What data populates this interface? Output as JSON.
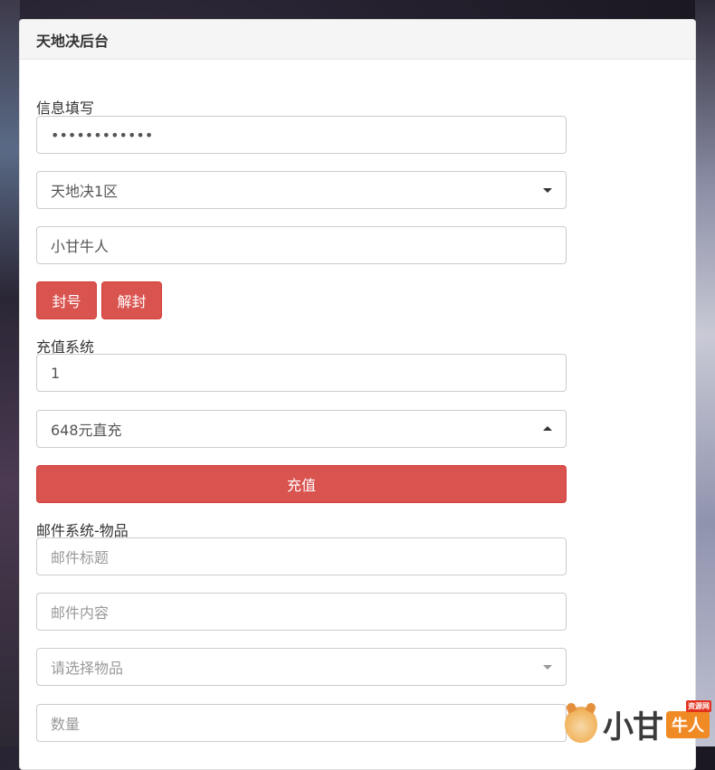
{
  "panel": {
    "title": "天地决后台"
  },
  "info_section": {
    "label": "信息填写",
    "password_value": "••••••••••••",
    "server_selected": "天地决1区",
    "player_name": "小甘牛人",
    "ban_button": "封号",
    "unban_button": "解封"
  },
  "recharge_section": {
    "label": "充值系统",
    "amount_value": "1",
    "package_selected": "648元直充",
    "recharge_button": "充值"
  },
  "mail_section": {
    "label": "邮件系统-物品",
    "title_placeholder": "邮件标题",
    "content_placeholder": "邮件内容",
    "item_placeholder": "请选择物品",
    "quantity_placeholder": "数量"
  },
  "watermark": {
    "text": "小甘",
    "badge": "牛人",
    "badge_small": "资源网"
  },
  "colors": {
    "danger": "#d9534f",
    "heading_bg": "#f5f5f5",
    "border": "#cccccc"
  }
}
